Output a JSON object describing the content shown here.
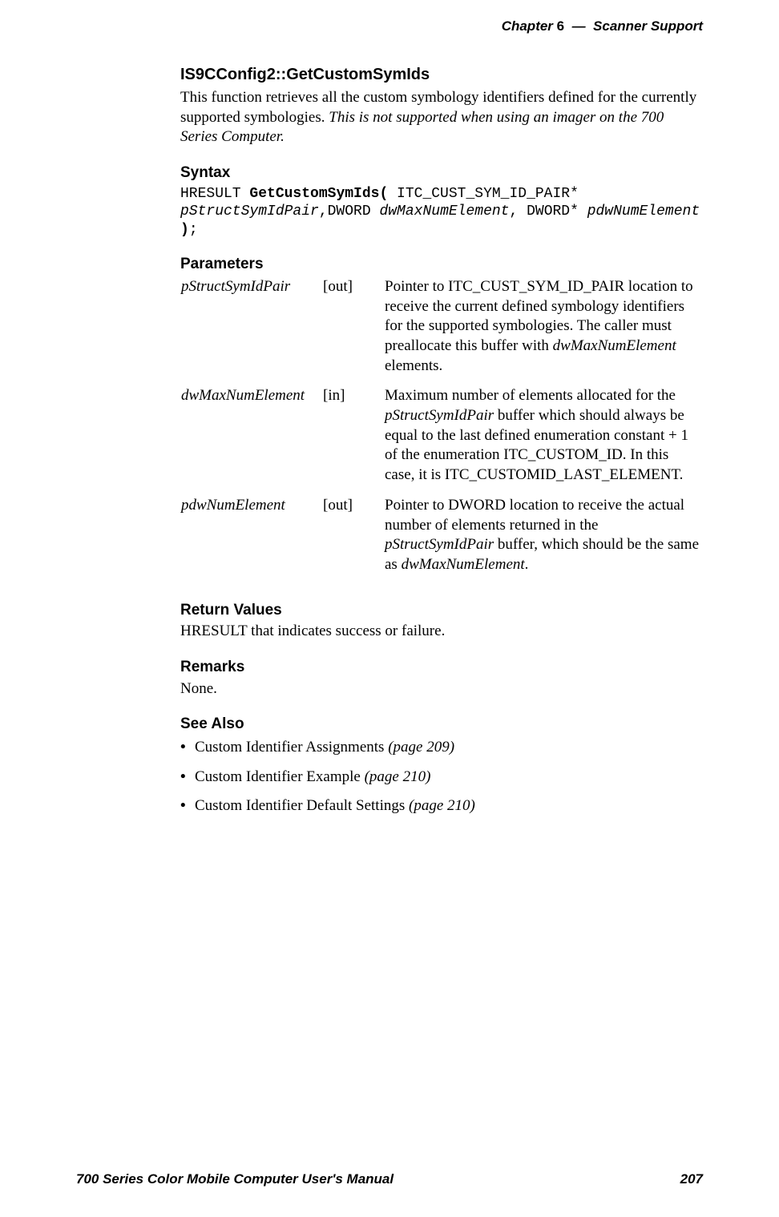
{
  "header": {
    "chapter_label": "Chapter",
    "chapter_number": "6",
    "sep": "—",
    "chapter_title": "Scanner Support"
  },
  "function": {
    "title": "IS9CConfig2::GetCustomSymIds",
    "intro_pre": "This function retrieves all the custom symbology identifiers defined for the currently supported symbologies. ",
    "intro_italic": "This is not supported when using an imager on the 700 Series Computer."
  },
  "syntax": {
    "heading": "Syntax",
    "line1_a": "HRESULT ",
    "line1_b": "GetCustomSymIds(",
    "line1_c": " ITC_CUST_SYM_ID_PAIR*",
    "line2_a": "pStructSymIdPair",
    "line2_b": ",DWORD ",
    "line2_c": "dwMaxNumElement",
    "line2_d": ", DWORD* ",
    "line2_e": "pdwNumElement",
    "line3_a": ")",
    "line3_b": ";"
  },
  "parameters": {
    "heading": "Parameters",
    "rows": [
      {
        "name": "pStructSymIdPair",
        "dir": "[out]",
        "desc_a": "Pointer to ITC_CUST_SYM_ID_PAIR location to receive the current defined symbology identifiers for the supported symbologies. The caller must preallocate this buffer with ",
        "desc_i1": "dwMaxNumElement",
        "desc_b": " elements."
      },
      {
        "name": "dwMaxNumElement",
        "dir": "[in]",
        "desc_a": "Maximum number of elements allocated for the ",
        "desc_i1": "pStructSymIdPair",
        "desc_b": " buffer which should always be equal to the last defined enumeration constant + 1 of the enumeration ITC_CUSTOM_ID. In this case, it is ITC_CUSTOMID_LAST_ELEMENT."
      },
      {
        "name": "pdwNumElement",
        "dir": "[out]",
        "desc_a": "Pointer to DWORD location to receive the actual number of elements returned in the ",
        "desc_i1": "pStructSymIdPair",
        "desc_b": " buffer, which should be the same as ",
        "desc_i2": "dwMaxNumElement",
        "desc_c": "."
      }
    ]
  },
  "return_values": {
    "heading": "Return Values",
    "text": "HRESULT that indicates success or failure."
  },
  "remarks": {
    "heading": "Remarks",
    "text": "None."
  },
  "see_also": {
    "heading": "See Also",
    "items": [
      {
        "text": "Custom Identifier Assignments ",
        "page": "(page 209)"
      },
      {
        "text": "Custom Identifier Example ",
        "page": "(page 210)"
      },
      {
        "text": "Custom Identifier Default Settings ",
        "page": "(page 210)"
      }
    ]
  },
  "footer": {
    "left": "700 Series Color Mobile Computer User's Manual",
    "right": "207"
  }
}
